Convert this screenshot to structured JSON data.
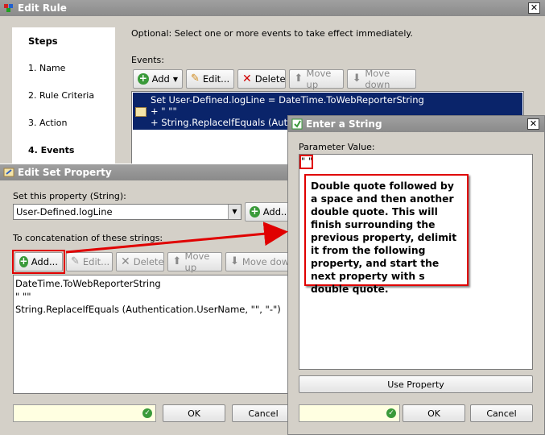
{
  "edit_rule": {
    "title": "Edit Rule",
    "close": "✕",
    "steps_heading": "Steps",
    "steps": [
      "1. Name",
      "2. Rule Criteria",
      "3. Action",
      "4. Events"
    ],
    "instruction": "Optional: Select one or more events to take effect immediately.",
    "events_label": "Events:",
    "toolbar": {
      "add": "Add",
      "edit": "Edit...",
      "delete": "Delete",
      "move_up": "Move up",
      "move_down": "Move down"
    },
    "events_lines": [
      "Set User-Defined.logLine = DateTime.ToWebReporterString",
      "+ \" \"\"",
      "+ String.ReplaceIfEquals (Authentic"
    ]
  },
  "set_property": {
    "title": "Edit Set Property",
    "set_label": "Set this property (String):",
    "property_value": "User-Defined.logLine",
    "add_label": "Add...",
    "concat_label": "To concatenation of these strings:",
    "toolbar": {
      "add": "Add...",
      "edit": "Edit...",
      "delete": "Delete",
      "move_up": "Move up",
      "move_down": "Move down"
    },
    "strings": [
      "DateTime.ToWebReporterString",
      "\" \"\"",
      "String.ReplaceIfEquals (Authentication.UserName, \"\", \"-\")"
    ],
    "ok": "OK",
    "cancel": "Cancel"
  },
  "enter_string": {
    "title": "Enter a String",
    "close": "✕",
    "param_label": "Parameter Value:",
    "param_value": "\" \"",
    "annotation": "Double quote followed by a space and then another double quote. This will finish surrounding the previous property, delimit it from the following property, and start the next property with s double quote.",
    "use_property": "Use Property",
    "ok": "OK",
    "cancel": "Cancel"
  },
  "colors": {
    "selection": "#0a246a",
    "annotation_red": "#e00000"
  }
}
